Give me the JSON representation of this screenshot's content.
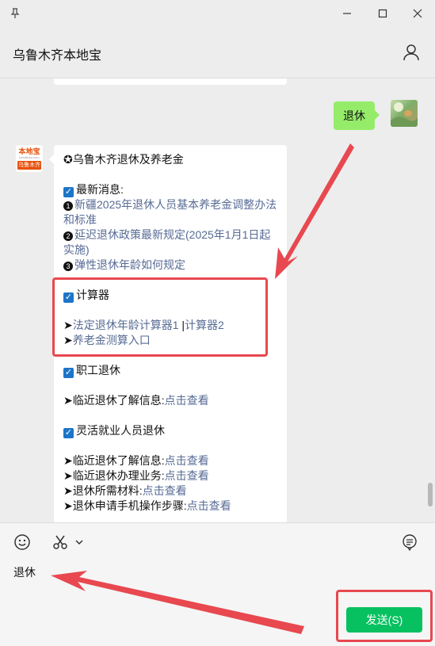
{
  "header": {
    "title": "乌鲁木齐本地宝"
  },
  "chat": {
    "sent_message": "退休",
    "bot_avatar": {
      "line1": "本地宝",
      "line2": "bendibao.com",
      "line3": "乌鲁木齐"
    },
    "bot_message": {
      "heading": "✪乌鲁木齐退休及养老金",
      "latest_label": "最新消息:",
      "news": [
        {
          "num": "1",
          "text": "新疆2025年退休人员基本养老金调整办法和标准"
        },
        {
          "num": "2",
          "text": "延迟退休政策最新规定(2025年1月1日起实施)"
        },
        {
          "num": "3",
          "text": "弹性退休年龄如何规定"
        }
      ],
      "calc_label": "计算器",
      "calc_links": {
        "prefix": "➤",
        "link1": "法定退休年龄计算器1",
        "sep": " |",
        "link2": "计算器2"
      },
      "pension_link": {
        "prefix": "➤",
        "text": "养老金测算入口"
      },
      "employee_label": "职工退休",
      "employee_item": {
        "prefix": "➤临近退休了解信息:",
        "link": "点击查看"
      },
      "flex_label": "灵活就业人员退休",
      "flex_items": [
        {
          "prefix": "➤临近退休了解信息:",
          "link": "点击查看"
        },
        {
          "prefix": "➤临近退休办理业务:",
          "link": "点击查看"
        },
        {
          "prefix": "➤退休所需材料:",
          "link": "点击查看"
        },
        {
          "prefix": "➤退休申请手机操作步骤:",
          "link": "点击查看"
        }
      ]
    }
  },
  "input": {
    "text": "退休",
    "send_label": "发送(S)"
  },
  "colors": {
    "accent": "#07c160",
    "sent_bubble": "#95ec69",
    "link": "#576b95",
    "annotation": "#e8484f"
  }
}
